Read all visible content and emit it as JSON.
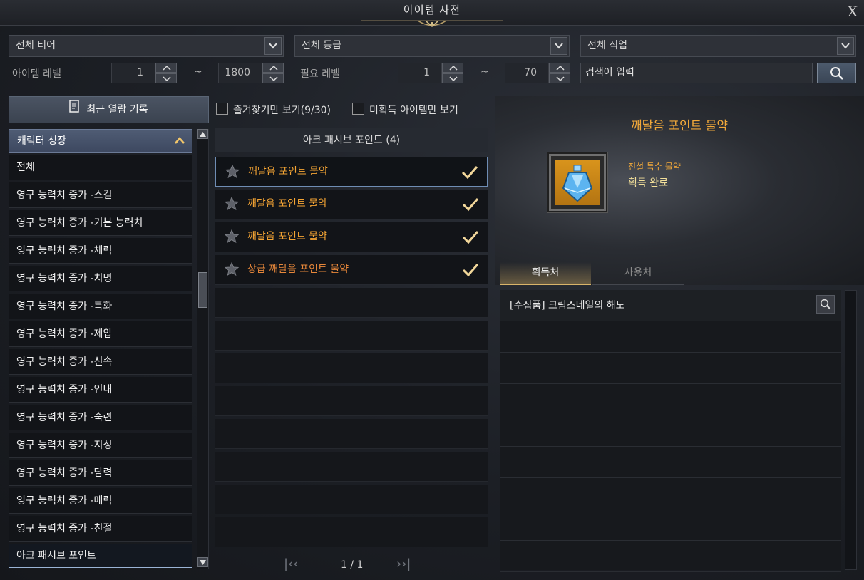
{
  "window": {
    "title": "아이템 사전",
    "close_label": "X"
  },
  "filters": {
    "tier": {
      "selected": "전체 티어"
    },
    "grade": {
      "selected": "전체 등급"
    },
    "class": {
      "selected": "전체 직업"
    },
    "item_level": {
      "label": "아이템 레벨",
      "min": "1",
      "max": "1800"
    },
    "required_level": {
      "label": "필요 레벨",
      "min": "1",
      "max": "70"
    },
    "range_separator": "~",
    "search": {
      "value": "검색어 입력"
    }
  },
  "sidebar": {
    "recent_button": "최근 열람 기록",
    "category_header": "캐릭터 성장",
    "items": [
      {
        "label": "전체"
      },
      {
        "label": "영구 능력치 증가 -스킬"
      },
      {
        "label": "영구 능력치 증가 -기본 능력치"
      },
      {
        "label": "영구 능력치 증가 -체력"
      },
      {
        "label": "영구 능력치 증가 -치명"
      },
      {
        "label": "영구 능력치 증가 -특화"
      },
      {
        "label": "영구 능력치 증가 -제압"
      },
      {
        "label": "영구 능력치 증가 -신속"
      },
      {
        "label": "영구 능력치 증가 -인내"
      },
      {
        "label": "영구 능력치 증가 -숙련"
      },
      {
        "label": "영구 능력치 증가 -지성"
      },
      {
        "label": "영구 능력치 증가 -담력"
      },
      {
        "label": "영구 능력치 증가 -매력"
      },
      {
        "label": "영구 능력치 증가 -친절"
      },
      {
        "label": "아크 패시브 포인트"
      }
    ],
    "selected_index": 14
  },
  "list": {
    "favorites_only": "즐겨찾기만 보기(9/30)",
    "unobtained_only": "미획득 아이템만 보기",
    "header": "아크 패시브 포인트 (4)",
    "items": [
      {
        "name": "깨달음 포인트 물약",
        "obtained": true
      },
      {
        "name": "깨달음 포인트 물약",
        "obtained": true
      },
      {
        "name": "깨달음 포인트 물약",
        "obtained": true
      },
      {
        "name": "상급 깨달음 포인트 물약",
        "obtained": true
      }
    ],
    "pagination": "1 / 1"
  },
  "detail": {
    "title": "깨달음 포인트 물약",
    "grade_type": "전설 특수 물약",
    "status": "획득 완료",
    "tabs": [
      {
        "label": "획득처"
      },
      {
        "label": "사용처"
      }
    ],
    "sources": [
      {
        "text": "[수집품] 크림스네일의 해도"
      }
    ]
  },
  "colors": {
    "legendary": "#f2a93a",
    "epic_orange": "#e7873a",
    "accent_blue": "#9ab4d6"
  }
}
